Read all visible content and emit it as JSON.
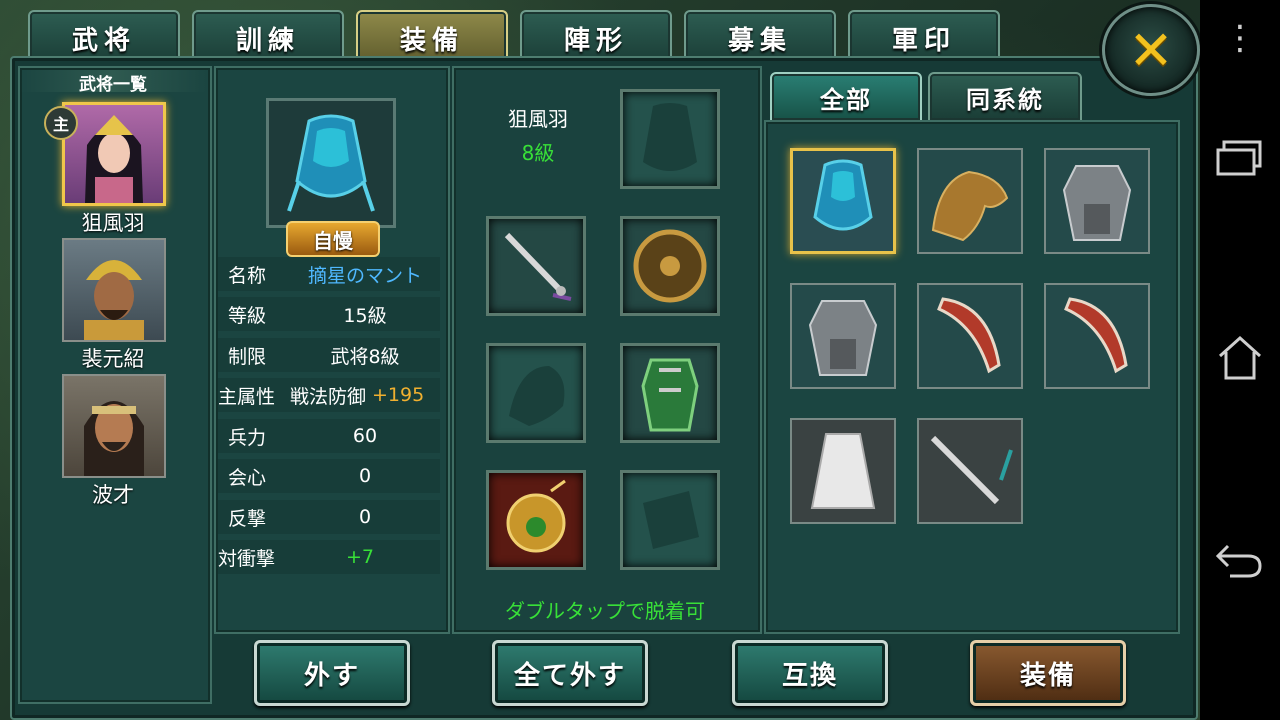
{
  "tabs": [
    {
      "label": "武将"
    },
    {
      "label": "訓練"
    },
    {
      "label": "装備"
    },
    {
      "label": "陣形"
    },
    {
      "label": "募集"
    },
    {
      "label": "軍印"
    }
  ],
  "active_tab": "装備",
  "close_glyph": "✕",
  "general_list": {
    "title": "武将一覧",
    "lead_badge": "主",
    "generals": [
      {
        "name": "狙風羽"
      },
      {
        "name": "裴元紹"
      },
      {
        "name": "波才"
      }
    ]
  },
  "item_detail": {
    "badge": "自慢",
    "name_label": "名称",
    "name_value": "摘星のマント",
    "rows": [
      {
        "label": "等級",
        "value": "15級"
      },
      {
        "label": "制限",
        "value": "武将8級"
      },
      {
        "label": "主属性",
        "value": "戦法防御",
        "bonus": "+195"
      },
      {
        "label": "兵力",
        "value": "60"
      },
      {
        "label": "会心",
        "value": "0"
      },
      {
        "label": "反撃",
        "value": "0"
      },
      {
        "label": "対衝撃",
        "value": "+7"
      }
    ]
  },
  "equipment": {
    "general_name": "狙風羽",
    "general_level": "8級",
    "hint": "ダブルタップで脱着可"
  },
  "inventory": {
    "tabs": [
      {
        "label": "全部"
      },
      {
        "label": "同系統"
      }
    ],
    "items": [
      {
        "icon": "cloak-icon"
      },
      {
        "icon": "horse-icon"
      },
      {
        "icon": "armor-icon"
      },
      {
        "icon": "armor-icon"
      },
      {
        "icon": "blade-icon"
      },
      {
        "icon": "blade-icon"
      },
      {
        "icon": "robe-icon"
      },
      {
        "icon": "sword-icon"
      }
    ]
  },
  "buttons": {
    "unequip": "外す",
    "unequip_all": "全て外す",
    "swap": "互換",
    "equip": "装備"
  },
  "colors": {
    "name_value": "#4fb8ff",
    "bonus": "#f0b030",
    "positive": "#38e038",
    "level": "#38e038"
  }
}
